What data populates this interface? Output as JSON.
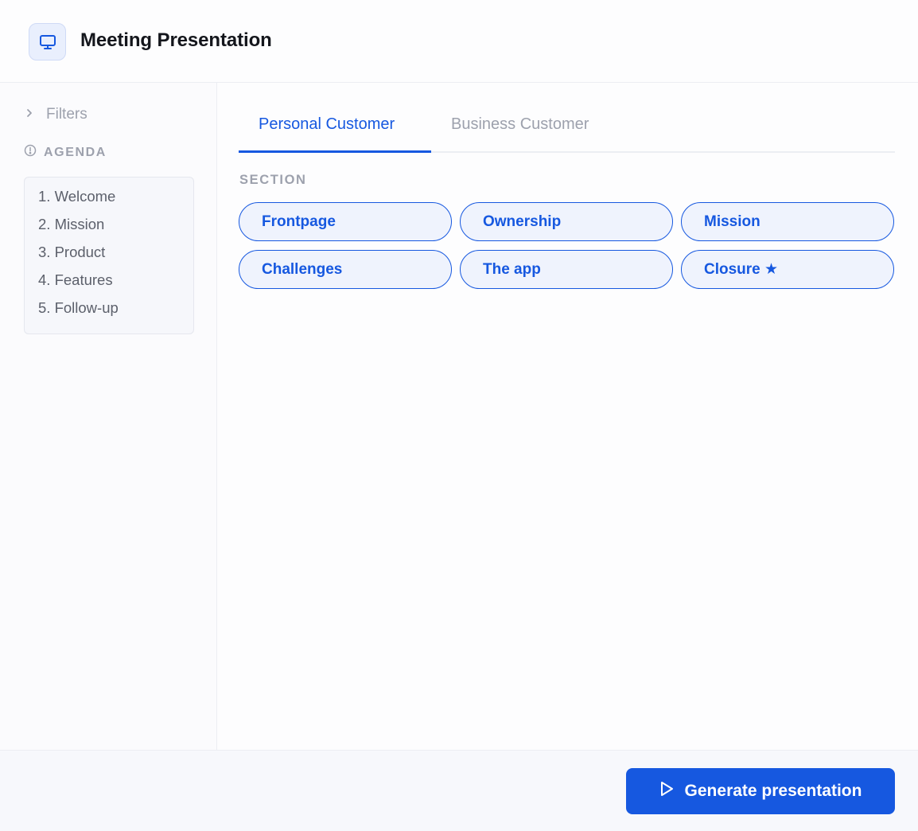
{
  "header": {
    "title": "Meeting Presentation",
    "icon": "monitor-icon"
  },
  "sidebar": {
    "filters_label": "Filters",
    "agenda_label": "AGENDA",
    "agenda_items": [
      "1. Welcome",
      "2. Mission",
      "3. Product",
      "4. Features",
      "5. Follow-up"
    ]
  },
  "main": {
    "tabs": [
      {
        "label": "Personal Customer",
        "active": true
      },
      {
        "label": "Business Customer",
        "active": false
      }
    ],
    "section_label": "SECTION",
    "sections": [
      "Frontpage",
      "Ownership",
      "Mission",
      "Challenges",
      "The app",
      "Closure ★"
    ]
  },
  "footer": {
    "generate_label": "Generate presentation"
  },
  "colors": {
    "accent": "#1658e0",
    "chip_bg": "#eff3fd",
    "muted_text": "#9da1ad"
  }
}
